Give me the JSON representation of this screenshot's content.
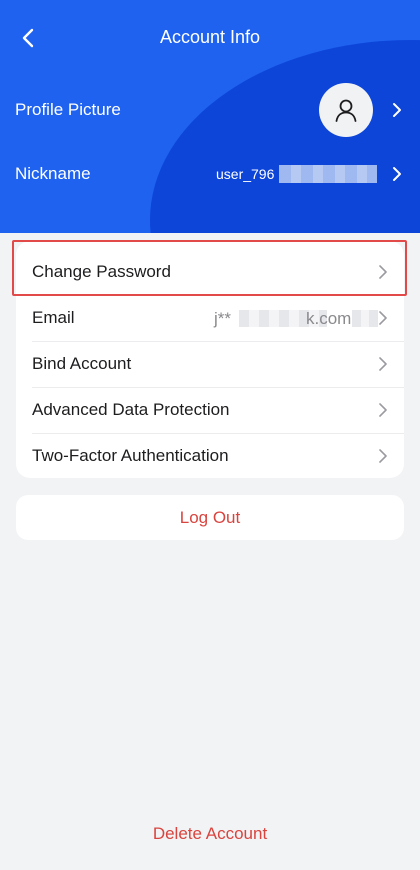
{
  "nav": {
    "title": "Account Info",
    "back_icon": "chevron-left-icon"
  },
  "profile": {
    "picture_label": "Profile Picture",
    "avatar_icon": "user-silhouette-icon",
    "nickname_label": "Nickname",
    "nickname_value": "user_796"
  },
  "settings": {
    "items": [
      {
        "label": "Change Password"
      },
      {
        "label": "Email",
        "value_prefix": "j**",
        "value_suffix": "k.com"
      },
      {
        "label": "Bind Account"
      },
      {
        "label": "Advanced Data Protection"
      },
      {
        "label": "Two-Factor Authentication"
      }
    ]
  },
  "actions": {
    "logout": "Log Out",
    "delete": "Delete Account"
  },
  "colors": {
    "header_blue": "#1650e6",
    "danger_red": "#d9443e",
    "highlight_border": "#e24a4a",
    "background": "#f2f3f5"
  }
}
